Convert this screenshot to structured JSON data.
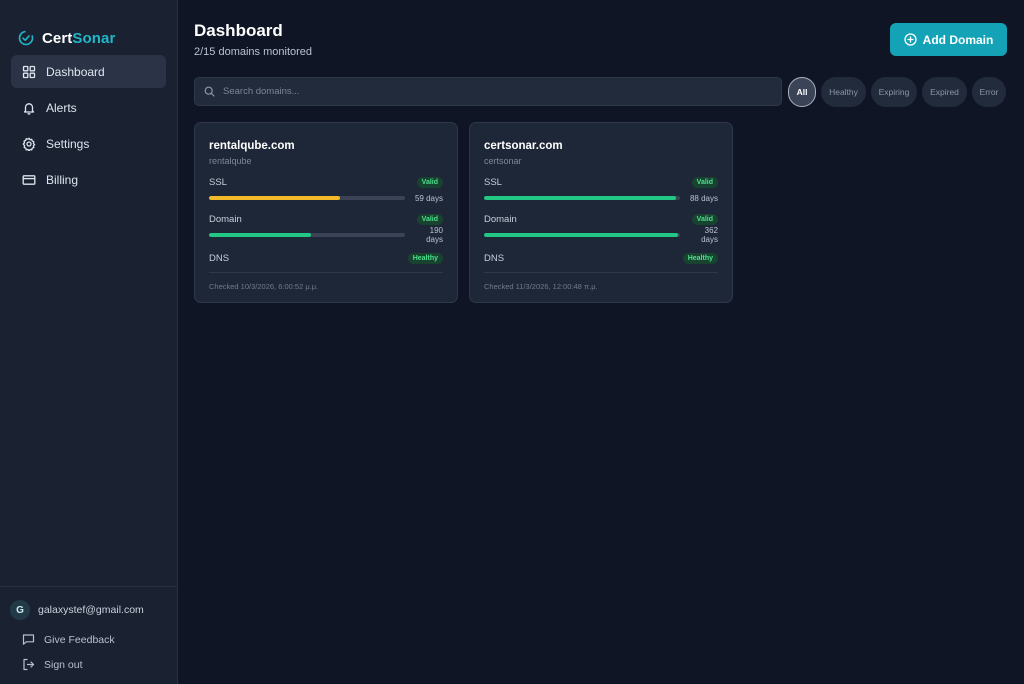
{
  "brand": {
    "name_part1": "Cert",
    "name_part2": "Sonar",
    "accent": "#1fb8c9"
  },
  "nav": [
    {
      "label": "Dashboard",
      "icon": "grid-icon",
      "active": true
    },
    {
      "label": "Alerts",
      "icon": "bell-icon",
      "active": false
    },
    {
      "label": "Settings",
      "icon": "gear-icon",
      "active": false
    },
    {
      "label": "Billing",
      "icon": "credit-card-icon",
      "active": false
    }
  ],
  "user": {
    "initial": "G",
    "email": "galaxystef@gmail.com"
  },
  "footer": {
    "feedback": "Give Feedback",
    "signout": "Sign out"
  },
  "header": {
    "title": "Dashboard",
    "subtitle": "2/15 domains monitored",
    "add_button": "Add Domain"
  },
  "search": {
    "placeholder": "Search domains..."
  },
  "filters": [
    "All",
    "Healthy",
    "Expiring",
    "Expired",
    "Error"
  ],
  "active_filter": "All",
  "domains": [
    {
      "domain": "rentalqube.com",
      "name": "rentalqube",
      "ssl": {
        "label": "SSL",
        "status": "Valid",
        "days": "59 days",
        "fill": 0.67,
        "color": "#f2b929"
      },
      "registration": {
        "label": "Domain",
        "status": "Valid",
        "days": "190 days",
        "fill": 0.52,
        "color": "#22c784"
      },
      "dns": {
        "label": "DNS",
        "status": "Healthy"
      },
      "checked": "Checked 10/3/2026, 6:00:52 μ.μ."
    },
    {
      "domain": "certsonar.com",
      "name": "certsonar",
      "ssl": {
        "label": "SSL",
        "status": "Valid",
        "days": "88 days",
        "fill": 0.98,
        "color": "#22c784"
      },
      "registration": {
        "label": "Domain",
        "status": "Valid",
        "days": "362 days",
        "fill": 0.99,
        "color": "#22c784"
      },
      "dns": {
        "label": "DNS",
        "status": "Healthy"
      },
      "checked": "Checked 11/3/2026, 12:00:48 π.μ."
    }
  ]
}
